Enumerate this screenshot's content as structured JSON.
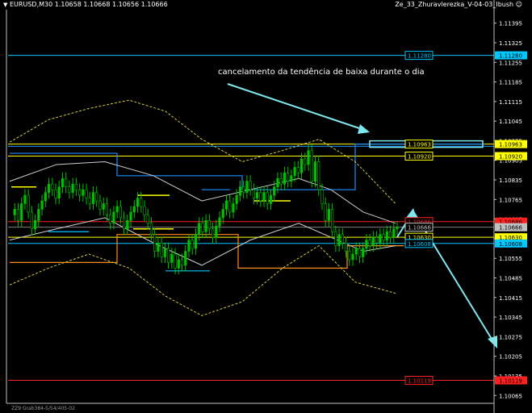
{
  "header": {
    "symbol_info": "EURUSD,M30  1.10658 1.10668 1.10656 1.10666",
    "indicator_name": "Ze_33_Zhuravlerezka_V-04-03_Ibush",
    "smiley_icon": "smiley-icon"
  },
  "annotation": {
    "text": "cancelamento da tendência de baixa durante o dia"
  },
  "footer": {
    "text": "ZZ9 Grab384-5/54/405-02"
  },
  "colors": {
    "background": "#000000",
    "bull_candle": "#00c000",
    "bear_candle": "#00c000",
    "arrow": "#7fe8ee",
    "highlight_line": "#ffff00",
    "resistance_red": "#ff2020",
    "channel_blue": "#1e90ff",
    "stop_orange": "#ff8c1a",
    "envelope_yellow": "#d4c84a",
    "band_white": "#cfcfcf",
    "pivot_cyan": "#00c8ff"
  },
  "chart_data": {
    "type": "candlestick",
    "symbol": "EURUSD",
    "timeframe": "M30",
    "last_price": 1.10666,
    "ylim": [
      1.1006,
      1.1142
    ],
    "yticks": [
      "1.11395",
      "1.11325",
      "1.11255",
      "1.11185",
      "1.11115",
      "1.11045",
      "1.10975",
      "1.10905",
      "1.10835",
      "1.10765",
      "1.10695",
      "1.10625",
      "1.10555",
      "1.10485",
      "1.10415",
      "1.10345",
      "1.10275",
      "1.10205",
      "1.10135",
      "1.10065"
    ],
    "price_labels": [
      {
        "value": "1.11280",
        "color": "#00c8ff",
        "price": 1.1128
      },
      {
        "value": "1.10963",
        "color": "#ffff00",
        "price": 1.10963
      },
      {
        "value": "1.10920",
        "color": "#ffff00",
        "price": 1.1092
      },
      {
        "value": "1.10686",
        "color": "#ff2020",
        "price": 1.10686
      },
      {
        "value": "1.10666",
        "color": "#c0c0c0",
        "price": 1.10666
      },
      {
        "value": "1.10630",
        "color": "#ffff00",
        "price": 1.1063
      },
      {
        "value": "1.10608",
        "color": "#00c8ff",
        "price": 1.10608
      },
      {
        "value": "1.10119",
        "color": "#ff2020",
        "price": 1.10119
      }
    ],
    "close_path": [
      1.1071,
      1.1073,
      1.1069,
      1.1075,
      1.1078,
      1.1072,
      1.1066,
      1.1069,
      1.1073,
      1.1076,
      1.1079,
      1.1082,
      1.108,
      1.1077,
      1.1081,
      1.1084,
      1.1081,
      1.1079,
      1.1082,
      1.108,
      1.1078,
      1.108,
      1.1077,
      1.1075,
      1.1079,
      1.1076,
      1.1073,
      1.1075,
      1.1071,
      1.1068,
      1.1072,
      1.1074,
      1.107,
      1.1066,
      1.1069,
      1.1072,
      1.1074,
      1.1077,
      1.1074,
      1.1071,
      1.1068,
      1.1064,
      1.1058,
      1.1061,
      1.1056,
      1.1059,
      1.1054,
      1.1057,
      1.1052,
      1.1055,
      1.1053,
      1.1058,
      1.1062,
      1.1059,
      1.1064,
      1.1068,
      1.1065,
      1.1069,
      1.1066,
      1.1063,
      1.1067,
      1.107,
      1.1073,
      1.1076,
      1.1072,
      1.1075,
      1.1078,
      1.1081,
      1.1079,
      1.1083,
      1.108,
      1.1077,
      1.1079,
      1.1076,
      1.1079,
      1.1075,
      1.1078,
      1.1081,
      1.1084,
      1.1082,
      1.1086,
      1.1083,
      1.1085,
      1.1088,
      1.1086,
      1.1091,
      1.1089,
      1.1094,
      1.1083,
      1.109,
      1.108,
      1.1075,
      1.1069,
      1.1073,
      1.1065,
      1.106,
      1.1064,
      1.1061,
      1.1058,
      1.1055,
      1.1057,
      1.1059,
      1.1056,
      1.1059,
      1.1062,
      1.106,
      1.1063,
      1.1061,
      1.1064,
      1.1062,
      1.1065,
      1.1063,
      1.1066,
      1.10666
    ],
    "horizontal_lines": [
      {
        "price": 1.1128,
        "color": "#00c8ff"
      },
      {
        "price": 1.10963,
        "color": "#ffff00"
      },
      {
        "price": 1.10955,
        "color": "#1e90ff"
      },
      {
        "price": 1.1092,
        "color": "#ffff00"
      },
      {
        "price": 1.10686,
        "color": "#ff2020"
      },
      {
        "price": 1.10666,
        "color": "#808080"
      },
      {
        "price": 1.1063,
        "color": "#ffff00"
      },
      {
        "price": 1.10608,
        "color": "#00c8ff"
      },
      {
        "price": 1.10119,
        "color": "#ff2020"
      }
    ]
  }
}
